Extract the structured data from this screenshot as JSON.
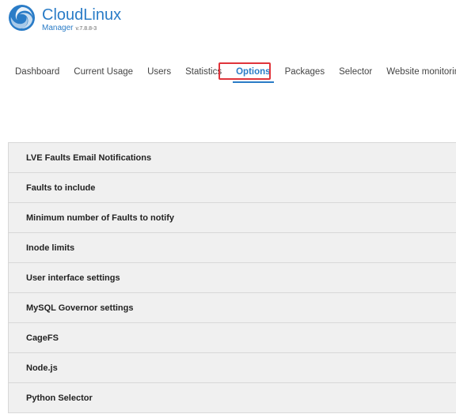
{
  "brand": {
    "title": "CloudLinux",
    "subtitle": "Manager",
    "version": "v.7.8.8-3"
  },
  "nav": {
    "items": [
      {
        "label": "Dashboard",
        "active": false
      },
      {
        "label": "Current Usage",
        "active": false
      },
      {
        "label": "Users",
        "active": false
      },
      {
        "label": "Statistics",
        "active": false
      },
      {
        "label": "Options",
        "active": true
      },
      {
        "label": "Packages",
        "active": false
      },
      {
        "label": "Selector",
        "active": false
      },
      {
        "label": "Website monitoring",
        "active": false
      }
    ]
  },
  "sections": [
    {
      "label": "LVE Faults Email Notifications"
    },
    {
      "label": "Faults to include"
    },
    {
      "label": "Minimum number of Faults to notify"
    },
    {
      "label": "Inode limits"
    },
    {
      "label": "User interface settings"
    },
    {
      "label": "MySQL Governor settings"
    },
    {
      "label": "CageFS"
    },
    {
      "label": "Node.js"
    },
    {
      "label": "Python Selector"
    }
  ],
  "colors": {
    "accent": "#2a7cc7",
    "highlight": "#e0343b",
    "row_bg": "#f0f0f0"
  }
}
